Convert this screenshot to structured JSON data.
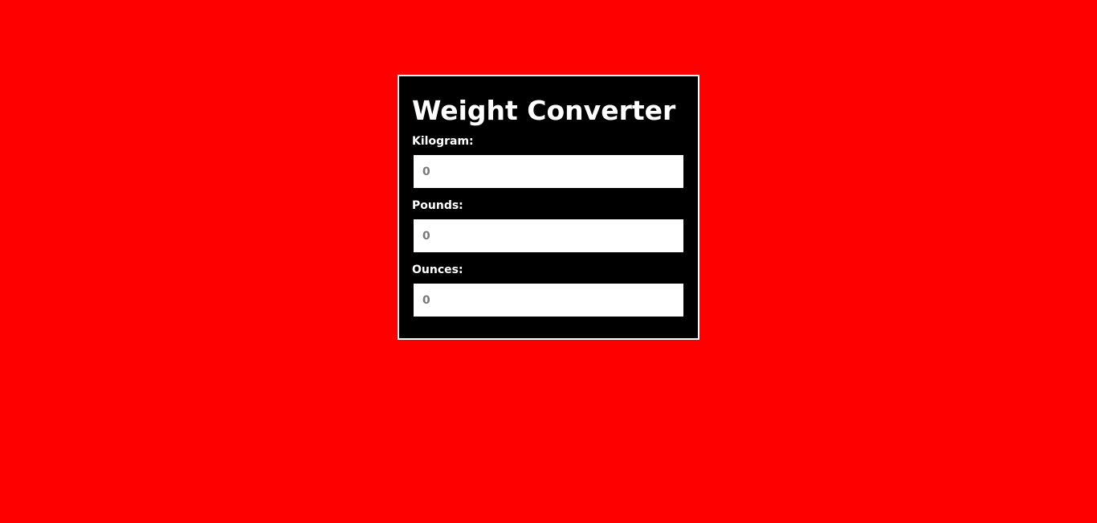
{
  "converter": {
    "title": "Weight Converter",
    "fields": [
      {
        "label": "Kilogram:",
        "placeholder": "0",
        "value": ""
      },
      {
        "label": "Pounds:",
        "placeholder": "0",
        "value": ""
      },
      {
        "label": "Ounces:",
        "placeholder": "0",
        "value": ""
      }
    ]
  },
  "colors": {
    "background": "#ff0000",
    "card": "#000000",
    "card_border": "#ffffff",
    "text": "#ffffff",
    "input_background": "#ffffff",
    "placeholder": "#777777"
  }
}
